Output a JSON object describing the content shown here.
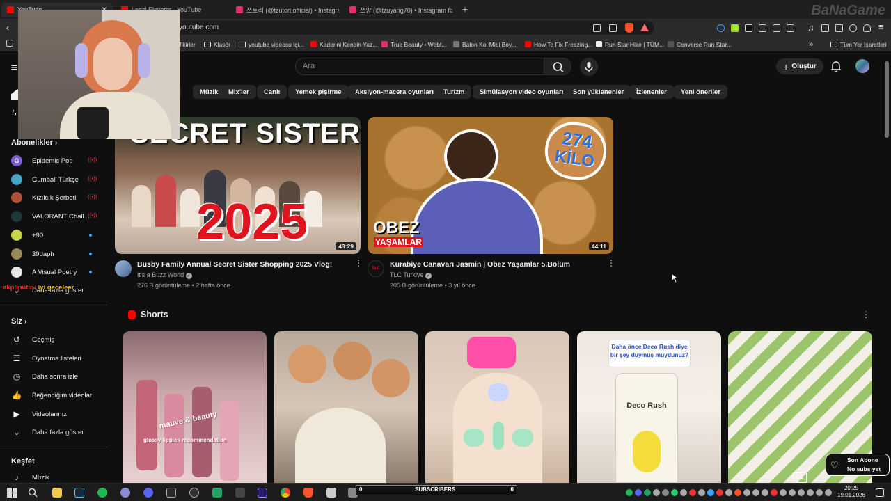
{
  "browser": {
    "tabs": [
      {
        "title": "YouTube",
        "active": true,
        "color": "#ff0000"
      },
      {
        "title": "Local Elevator - YouTube",
        "active": false,
        "color": "#ff0000"
      },
      {
        "title": "쯔토리 (@tzutori.official) • Instagram",
        "active": false,
        "color": "#e1306c"
      },
      {
        "title": "쯔양 (@tzuyang70) • Instagram foto",
        "active": false,
        "color": "#e1306c"
      }
    ],
    "new_tab_glyph": "+",
    "url": "youtube.com",
    "bookmarks": [
      {
        "label": "fikirler",
        "type": "text"
      },
      {
        "label": "Klasör",
        "type": "folder"
      },
      {
        "label": "youtube videosu içi...",
        "type": "folder"
      },
      {
        "label": "Kaderini Kendin Yaz...",
        "type": "youtube",
        "color": "#ff0000"
      },
      {
        "label": "True Beauty • Webt...",
        "type": "webtoon",
        "color": "#e1306c"
      },
      {
        "label": "Balon Kol Midi Boy...",
        "type": "site",
        "color": "#777777"
      },
      {
        "label": "How To Fix Freezing...",
        "type": "youtube",
        "color": "#ff0000"
      },
      {
        "label": "Run Star Hike | TÜM...",
        "type": "site",
        "color": "#222222"
      },
      {
        "label": "Converse Run Star...",
        "type": "site",
        "color": "#333333"
      }
    ],
    "bookmarks_overflow": "»",
    "all_bookmarks": "Tüm Yer İşaretleri",
    "corner_watermark": "BaNaGame"
  },
  "youtube": {
    "search_placeholder": "Ara",
    "create_label": "Oluştur",
    "chips": [
      "Müzik",
      "Mix'ler",
      "Canlı",
      "Yemek pişirme",
      "Aksiyon-macera oyunları",
      "Turizm",
      "Simülasyon video oyunları",
      "Son yüklenenler",
      "İzlenenler",
      "Yeni öneriler"
    ],
    "sidebar": {
      "subscriptions_header": "Abonelikler",
      "channels": [
        {
          "name": "Epidemic Pop",
          "status": "live",
          "color": "#7b5cd6",
          "initial": "G"
        },
        {
          "name": "Gumball Türkçe",
          "status": "live",
          "color": "#4aa3c7",
          "initial": ""
        },
        {
          "name": "Kızılcık Şerbeti",
          "status": "live",
          "color": "#b0523a",
          "initial": ""
        },
        {
          "name": "VALORANT Chall...",
          "status": "live",
          "color": "#1c3a3a",
          "initial": ""
        },
        {
          "name": "+90",
          "status": "new",
          "color": "#c8d246",
          "initial": ""
        },
        {
          "name": "39daph",
          "status": "new",
          "color": "#9a8a55",
          "initial": ""
        },
        {
          "name": "A Visual Poetry",
          "status": "new",
          "color": "#e8e8e8",
          "initial": ""
        }
      ],
      "show_more_subs": "Daha fazla göster",
      "you_header": "Siz",
      "you_items": [
        {
          "label": "Geçmiş",
          "icon": "history-icon",
          "glyph": "↺"
        },
        {
          "label": "Oynatma listeleri",
          "icon": "playlist-icon",
          "glyph": "☰"
        },
        {
          "label": "Daha sonra izle",
          "icon": "watch-later-icon",
          "glyph": "◷"
        },
        {
          "label": "Beğendiğim videolar",
          "icon": "like-icon",
          "glyph": "👍"
        },
        {
          "label": "Videolarınız",
          "icon": "your-videos-icon",
          "glyph": "▶"
        },
        {
          "label": "Daha fazla göster",
          "icon": "chevron-down-icon",
          "glyph": "⌄"
        }
      ],
      "explore_header": "Keşfet",
      "explore_items": [
        {
          "label": "Müzik",
          "icon": "music-icon",
          "glyph": "♪"
        }
      ]
    },
    "videos": [
      {
        "title": "Busby Family Annual Secret Sister Shopping 2025 Vlog!",
        "channel": "It's a Buzz World",
        "verified": true,
        "views": "276 B görüntüleme",
        "age": "2 hafta önce",
        "duration": "43:29",
        "thumb_text_top": "SECRET SISTER",
        "thumb_text_big": "2025"
      },
      {
        "title": "Kurabiye Canavarı Jasmin | Obez Yaşamlar 5.Bölüm",
        "channel": "TLC Turkiye",
        "verified": true,
        "views": "205 B görüntüleme",
        "age": "3 yıl önce",
        "duration": "44:11",
        "thumb_badge_line1": "274",
        "thumb_badge_line2": "KİLO",
        "thumb_show_line1": "OBEZ",
        "thumb_show_line2": "YAŞAMLAR",
        "channel_avatar_text": "TLC"
      }
    ],
    "shorts_header": "Shorts",
    "shorts": [
      {
        "caption": "mauve & beauty",
        "caption2": "glossy lippies recommendation"
      },
      {
        "caption": ""
      },
      {
        "caption": ""
      },
      {
        "caption": "Daha önce Deco Rush diye bir şey duymuş muydunuz?",
        "brand": "Deco Rush"
      },
      {
        "caption": ""
      }
    ]
  },
  "overlays": {
    "chat_user": "akpliputin:",
    "chat_message": "iyi geceleer",
    "follow_widget_line1": "Son Abone",
    "follow_widget_line2": "No subs yet",
    "subs_bar_left": "0",
    "subs_bar_label": "SUBSCRIBERS",
    "subs_bar_right": "6",
    "subs_progress": 0
  },
  "taskbar": {
    "time": "20:25",
    "date": "19.01.2026"
  }
}
